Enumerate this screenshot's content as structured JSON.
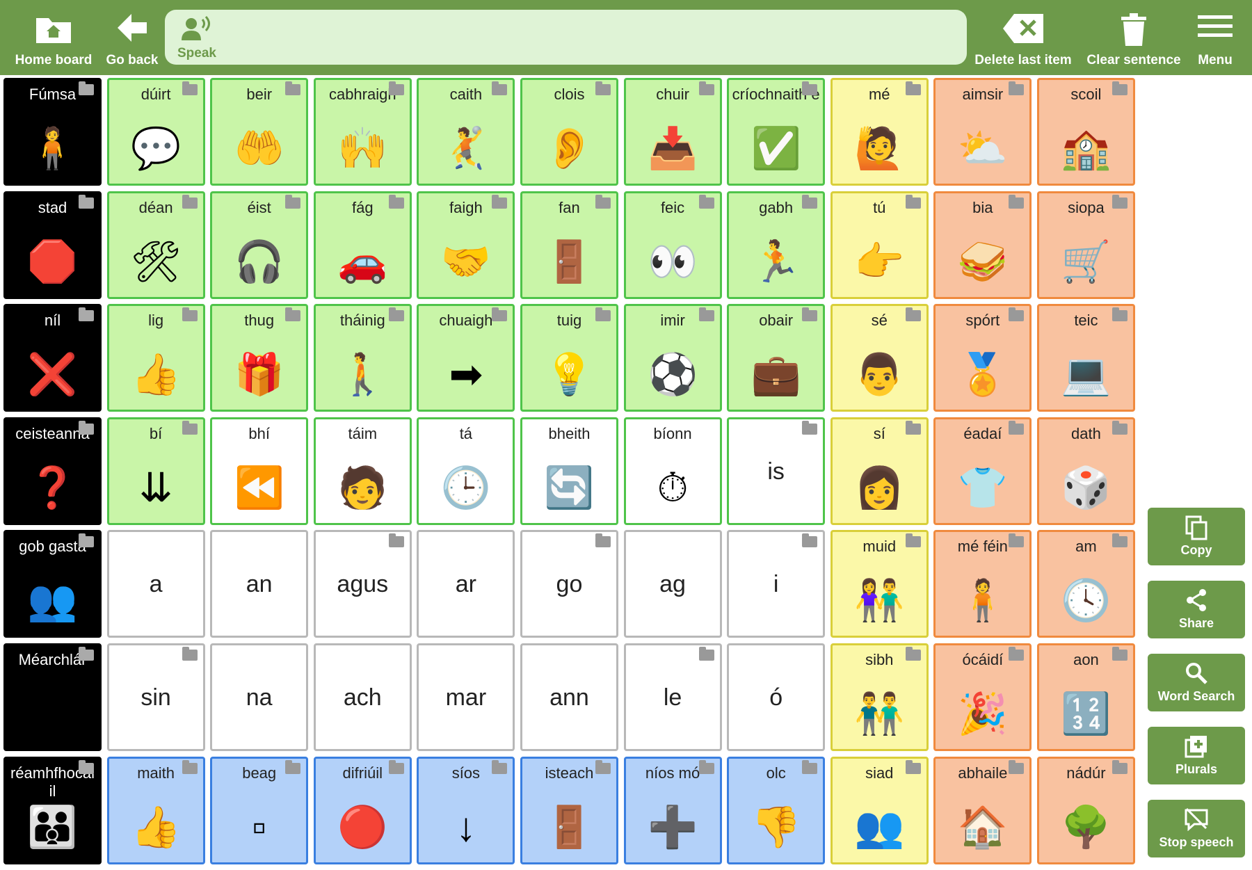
{
  "toolbar": {
    "home": "Home board",
    "back": "Go back",
    "speak": "Speak",
    "delete": "Delete last item",
    "clear": "Clear sentence",
    "menu": "Menu"
  },
  "side": {
    "copy": "Copy",
    "share": "Share",
    "word_search": "Word Search",
    "plurals": "Plurals",
    "stop_speech": "Stop speech"
  },
  "colors": {
    "bar": "#6d9a4a",
    "green": "#c9f5a8",
    "yellow": "#fbf8a8",
    "orange": "#f9c2a0",
    "blue": "#b3d1f9"
  },
  "grid": [
    [
      {
        "label": "Fúmsa",
        "style": "black",
        "folder": true,
        "icon": "person-green-icon"
      },
      {
        "label": "dúirt",
        "style": "green",
        "folder": true,
        "icon": "say-icon"
      },
      {
        "label": "beir",
        "style": "green",
        "folder": true,
        "icon": "catch-icon"
      },
      {
        "label": "cabhraigh",
        "style": "green",
        "folder": true,
        "icon": "help-icon"
      },
      {
        "label": "caith",
        "style": "green",
        "folder": true,
        "icon": "throw-icon"
      },
      {
        "label": "clois",
        "style": "green",
        "folder": true,
        "icon": "hear-icon"
      },
      {
        "label": "chuir",
        "style": "green",
        "folder": true,
        "icon": "put-icon"
      },
      {
        "label": "críochnaith e",
        "style": "green",
        "folder": true,
        "icon": "finish-icon"
      },
      {
        "label": "mé",
        "style": "yellow",
        "folder": true,
        "icon": "me-icon"
      },
      {
        "label": "aimsir",
        "style": "orange",
        "folder": true,
        "icon": "weather-icon"
      },
      {
        "label": "scoil",
        "style": "orange",
        "folder": true,
        "icon": "school-icon"
      }
    ],
    [
      {
        "label": "stad",
        "style": "black",
        "folder": true,
        "icon": "stop-sign-icon"
      },
      {
        "label": "déan",
        "style": "green",
        "folder": true,
        "icon": "make-icon"
      },
      {
        "label": "éist",
        "style": "green",
        "folder": true,
        "icon": "listen-icon"
      },
      {
        "label": "fág",
        "style": "green",
        "folder": true,
        "icon": "car-icon"
      },
      {
        "label": "faigh",
        "style": "green",
        "folder": true,
        "icon": "get-icon"
      },
      {
        "label": "fan",
        "style": "green",
        "folder": true,
        "icon": "wait-icon"
      },
      {
        "label": "feic",
        "style": "green",
        "folder": true,
        "icon": "see-icon"
      },
      {
        "label": "gabh",
        "style": "green",
        "folder": true,
        "icon": "take-icon"
      },
      {
        "label": "tú",
        "style": "yellow",
        "folder": true,
        "icon": "you-icon"
      },
      {
        "label": "bia",
        "style": "orange",
        "folder": true,
        "icon": "food-icon"
      },
      {
        "label": "siopa",
        "style": "orange",
        "folder": true,
        "icon": "shop-icon"
      }
    ],
    [
      {
        "label": "níl",
        "style": "black",
        "folder": true,
        "icon": "red-x-icon"
      },
      {
        "label": "lig",
        "style": "green",
        "folder": true,
        "icon": "let-icon"
      },
      {
        "label": "thug",
        "style": "green",
        "folder": true,
        "icon": "give-icon"
      },
      {
        "label": "tháinig",
        "style": "green",
        "folder": true,
        "icon": "came-icon"
      },
      {
        "label": "chuaigh",
        "style": "green",
        "folder": true,
        "icon": "went-icon"
      },
      {
        "label": "tuig",
        "style": "green",
        "folder": true,
        "icon": "understand-icon"
      },
      {
        "label": "imir",
        "style": "green",
        "folder": true,
        "icon": "play-icon"
      },
      {
        "label": "obair",
        "style": "green",
        "folder": true,
        "icon": "work-icon"
      },
      {
        "label": "sé",
        "style": "yellow",
        "folder": true,
        "icon": "he-icon"
      },
      {
        "label": "spórt",
        "style": "orange",
        "folder": true,
        "icon": "sport-icon"
      },
      {
        "label": "teic",
        "style": "orange",
        "folder": true,
        "icon": "tech-icon"
      }
    ],
    [
      {
        "label": "ceisteanna",
        "style": "black",
        "folder": true,
        "icon": "question-mark-icon"
      },
      {
        "label": "bí",
        "style": "green",
        "folder": true,
        "icon": "be-icon"
      },
      {
        "label": "bhí",
        "style": "whiteg",
        "folder": false,
        "icon": "past-clock-icon"
      },
      {
        "label": "táim",
        "style": "whiteg",
        "folder": false,
        "icon": "i-am-icon"
      },
      {
        "label": "tá",
        "style": "whiteg",
        "folder": false,
        "icon": "present-clock-icon"
      },
      {
        "label": "bheith",
        "style": "whiteg",
        "folder": false,
        "icon": "cycle-icon"
      },
      {
        "label": "bíonn",
        "style": "whiteg",
        "folder": false,
        "icon": "habitual-clock-icon"
      },
      {
        "label": "",
        "style": "whiteg",
        "folder": true,
        "big": "is"
      },
      {
        "label": "sí",
        "style": "yellow",
        "folder": true,
        "icon": "she-icon"
      },
      {
        "label": "éadaí",
        "style": "orange",
        "folder": true,
        "icon": "clothes-icon"
      },
      {
        "label": "dath",
        "style": "orange",
        "folder": true,
        "icon": "colour-cube-icon"
      }
    ],
    [
      {
        "label": "gob gasta",
        "style": "black",
        "folder": true,
        "icon": "chat-icon"
      },
      {
        "label": "",
        "style": "white",
        "folder": false,
        "big": "a"
      },
      {
        "label": "",
        "style": "white",
        "folder": false,
        "big": "an"
      },
      {
        "label": "",
        "style": "white",
        "folder": true,
        "big": "agus"
      },
      {
        "label": "",
        "style": "white",
        "folder": false,
        "big": "ar"
      },
      {
        "label": "",
        "style": "white",
        "folder": true,
        "big": "go"
      },
      {
        "label": "",
        "style": "white",
        "folder": false,
        "big": "ag"
      },
      {
        "label": "",
        "style": "white",
        "folder": true,
        "big": "i"
      },
      {
        "label": "muid",
        "style": "yellow",
        "folder": true,
        "icon": "we-icon"
      },
      {
        "label": "mé féin",
        "style": "orange",
        "folder": true,
        "icon": "myself-icon"
      },
      {
        "label": "am",
        "style": "orange",
        "folder": true,
        "icon": "clock-icon"
      }
    ],
    [
      {
        "label": "Méarchlár",
        "style": "black",
        "folder": true,
        "icon": "keyboard-icon"
      },
      {
        "label": "",
        "style": "white",
        "folder": true,
        "big": "sin"
      },
      {
        "label": "",
        "style": "white",
        "folder": false,
        "big": "na"
      },
      {
        "label": "",
        "style": "white",
        "folder": false,
        "big": "ach"
      },
      {
        "label": "",
        "style": "white",
        "folder": false,
        "big": "mar"
      },
      {
        "label": "",
        "style": "white",
        "folder": false,
        "big": "ann"
      },
      {
        "label": "",
        "style": "white",
        "folder": true,
        "big": "le"
      },
      {
        "label": "",
        "style": "white",
        "folder": false,
        "big": "ó"
      },
      {
        "label": "sibh",
        "style": "yellow",
        "folder": true,
        "icon": "you-plural-icon"
      },
      {
        "label": "ócáidí",
        "style": "orange",
        "folder": true,
        "icon": "party-icon"
      },
      {
        "label": "aon",
        "style": "orange",
        "folder": true,
        "icon": "numbers-icon"
      }
    ],
    [
      {
        "label": "réamhfhocal il",
        "style": "black",
        "folder": true,
        "icon": "crowd-icon"
      },
      {
        "label": "maith",
        "style": "blue",
        "folder": true,
        "icon": "good-icon"
      },
      {
        "label": "beag",
        "style": "blue",
        "folder": true,
        "icon": "small-icon"
      },
      {
        "label": "difriúil",
        "style": "blue",
        "folder": true,
        "icon": "different-icon"
      },
      {
        "label": "síos",
        "style": "blue",
        "folder": true,
        "icon": "down-arrow-icon"
      },
      {
        "label": "isteach",
        "style": "blue",
        "folder": true,
        "icon": "in-icon"
      },
      {
        "label": "níos mó",
        "style": "blue",
        "folder": true,
        "icon": "more-icon"
      },
      {
        "label": "olc",
        "style": "blue",
        "folder": true,
        "icon": "bad-icon"
      },
      {
        "label": "siad",
        "style": "yellow",
        "folder": true,
        "icon": "they-icon"
      },
      {
        "label": "abhaile",
        "style": "orange",
        "folder": true,
        "icon": "house-icon"
      },
      {
        "label": "nádúr",
        "style": "orange",
        "folder": true,
        "icon": "nature-icon"
      }
    ]
  ]
}
